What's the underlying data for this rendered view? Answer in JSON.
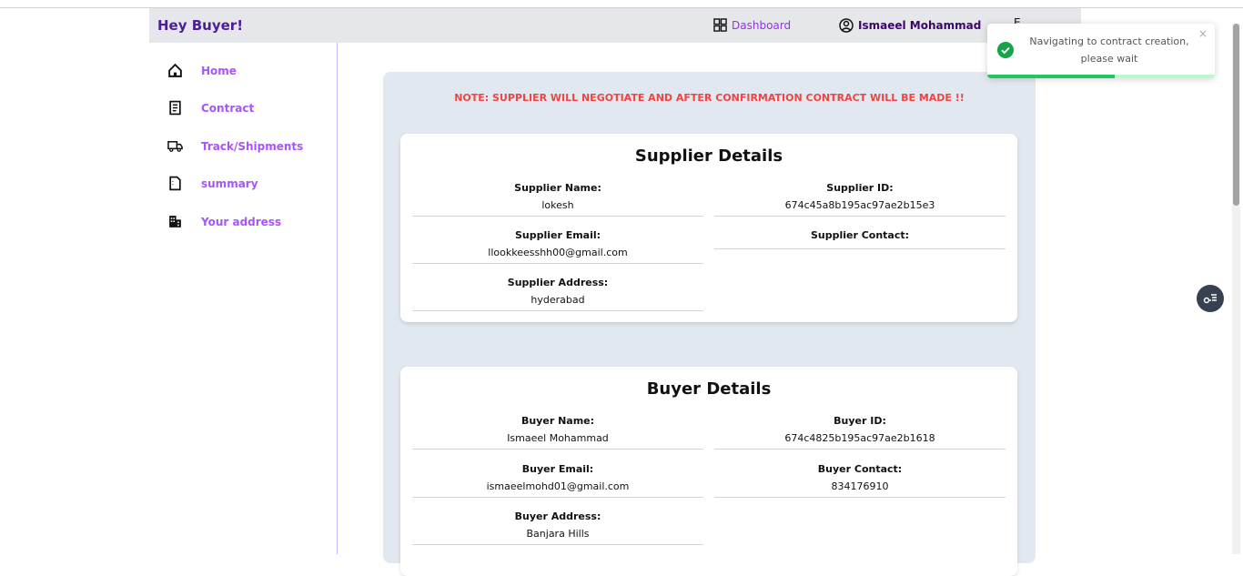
{
  "navbar": {
    "brand": "Hey Buyer!",
    "dashboard_label": "Dashboard",
    "user_name": "Ismaeel Mohammad",
    "extra_label": "E"
  },
  "sidebar": {
    "items": [
      {
        "label": "Home",
        "icon": "home-icon"
      },
      {
        "label": "Contract",
        "icon": "document-icon"
      },
      {
        "label": "Track/Shipments",
        "icon": "truck-icon"
      },
      {
        "label": "summary",
        "icon": "file-icon"
      },
      {
        "label": "Your address",
        "icon": "building-icon"
      }
    ]
  },
  "note": "NOTE: SUPPLIER WILL NEGOTIATE AND AFTER CONFIRMATION CONTRACT WILL BE MADE !!",
  "supplier": {
    "title": "Supplier Details",
    "name_label": "Supplier Name:",
    "name": "lokesh",
    "id_label": "Supplier ID:",
    "id": "674c45a8b195ac97ae2b15e3",
    "email_label": "Supplier Email:",
    "email": "llookkeesshh00@gmail.com",
    "contact_label": "Supplier Contact:",
    "contact": "",
    "address_label": "Supplier Address:",
    "address": "hyderabad"
  },
  "buyer": {
    "title": "Buyer Details",
    "name_label": "Buyer Name:",
    "name": "Ismaeel Mohammad",
    "id_label": "Buyer ID:",
    "id": "674c4825b195ac97ae2b1618",
    "email_label": "Buyer Email:",
    "email": "ismaeelmohd01@gmail.com",
    "contact_label": "Buyer Contact:",
    "contact": "834176910",
    "address_label": "Buyer Address:",
    "address": "Banjara Hills"
  },
  "toast": {
    "message": "Navigating to contract creation, please wait",
    "close": "×",
    "progress": 0.56
  },
  "colors": {
    "accent": "#a855f7",
    "brand": "#4c1d95",
    "note": "#ef4444",
    "success": "#22c55e"
  }
}
